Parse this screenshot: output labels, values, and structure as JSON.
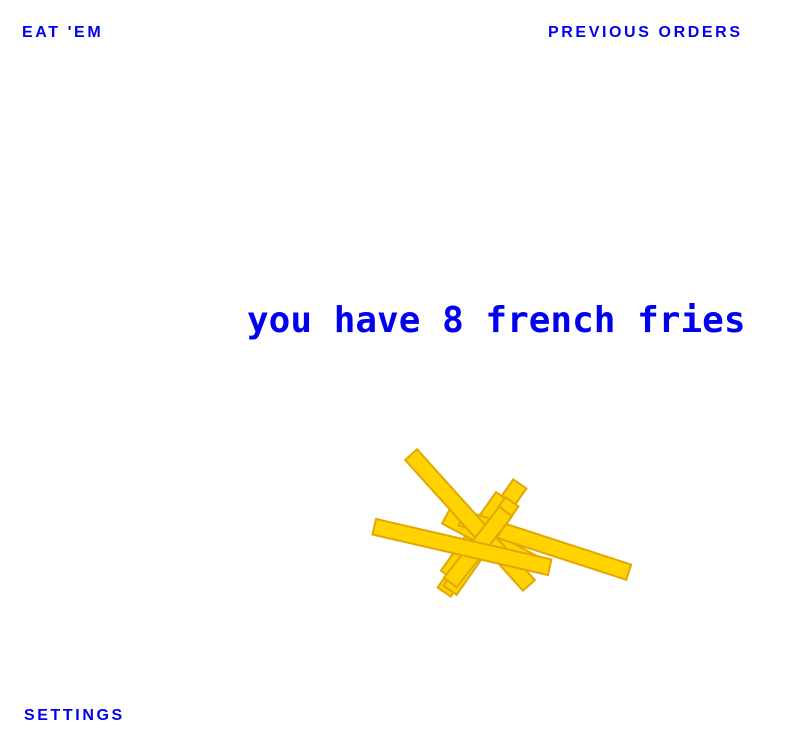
{
  "nav": {
    "eat_label": "EAT 'EM",
    "previous_orders_label": "PREVIOUS ORDERS",
    "settings_label": "SETTINGS"
  },
  "status": {
    "message": "you have 8 french fries"
  },
  "fries": {
    "count": 8,
    "fill_color": "#ffd200",
    "edge_color": "#e0a800"
  },
  "colors": {
    "link": "#0000ee",
    "background": "#ffffff"
  }
}
